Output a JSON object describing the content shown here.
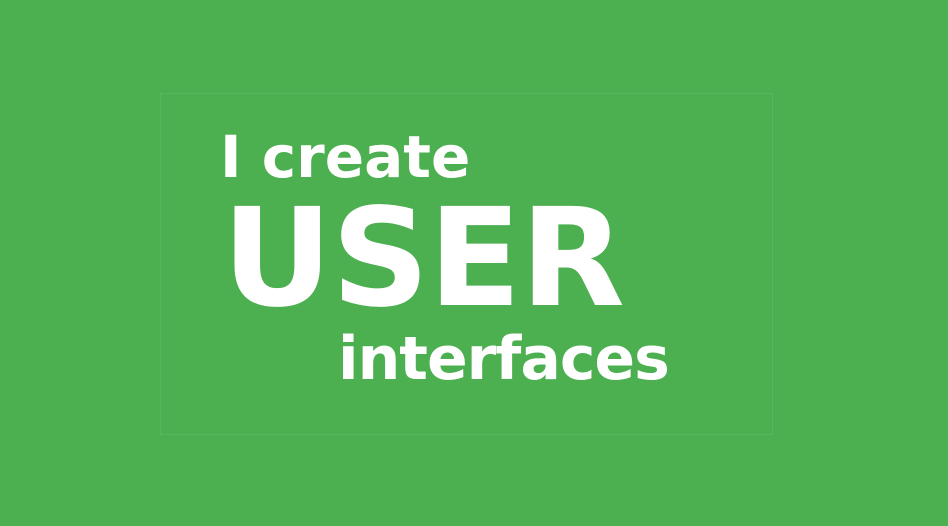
{
  "banner": {
    "line_1": "I create",
    "line_2": "USER",
    "line_3": "interfaces"
  },
  "colors": {
    "background": "#4caf50",
    "text": "#ffffff"
  }
}
